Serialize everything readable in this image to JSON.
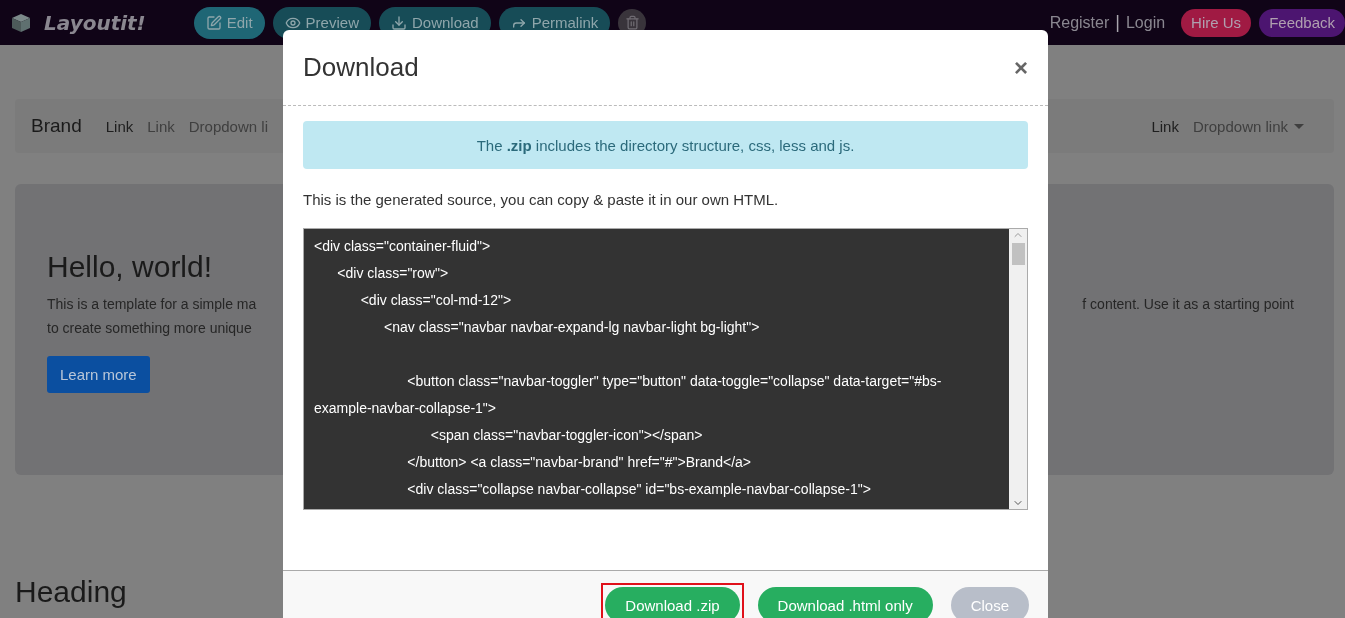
{
  "topbar": {
    "logo": "Layoutit!",
    "tools": [
      {
        "kind": "edit",
        "label": "Edit",
        "selected": true
      },
      {
        "kind": "preview",
        "label": "Preview",
        "selected": false
      },
      {
        "kind": "download",
        "label": "Download",
        "selected": false
      },
      {
        "kind": "permalink",
        "label": "Permalink",
        "selected": false
      },
      {
        "kind": "trash",
        "selected": false
      }
    ],
    "account": [
      {
        "kind": "link",
        "text": "Register"
      },
      {
        "kind": "separator",
        "text": "|"
      },
      {
        "kind": "link",
        "text": "Login"
      }
    ],
    "hire": "Hire Us",
    "feedback": "Feedback"
  },
  "page": {
    "navbar": {
      "brand": "Brand",
      "left_links": [
        {
          "label": "Link",
          "selected": true
        },
        {
          "label": "Link",
          "selected": false
        },
        {
          "label": "Dropdown li",
          "selected": false
        }
      ],
      "right_links": [
        {
          "label": "Link",
          "selected": true
        },
        {
          "label": "Dropdown link",
          "selected": false,
          "dropdown": true
        }
      ]
    },
    "jumbotron": {
      "title": "Hello, world!",
      "text_left": [
        "This is a template for a simple ma",
        "to create something more unique"
      ],
      "text_right": "f content. Use it as a starting point",
      "button": "Learn more"
    },
    "heading": "Heading"
  },
  "modal": {
    "title": "Download",
    "close": "×",
    "info": "The **.zip** includes the directory structure, css, less and js.",
    "intro": "This is the generated source, you can copy & paste it in our own HTML.",
    "code": "<div class=\"container-fluid\">\n\t<div class=\"row\">\n\t\t<div class=\"col-md-12\">\n\t\t\t<nav class=\"navbar navbar-expand-lg navbar-light bg-light\">\n\n\t\t\t\t<button class=\"navbar-toggler\" type=\"button\" data-toggle=\"collapse\" data-target=\"#bs-example-navbar-collapse-1\">\n\t\t\t\t\t<span class=\"navbar-toggler-icon\"></span>\n\t\t\t\t</button> <a class=\"navbar-brand\" href=\"#\">Brand</a>\n\t\t\t\t<div class=\"collapse navbar-collapse\" id=\"bs-example-navbar-collapse-1\">",
    "buttons": [
      {
        "label": "Download .zip",
        "kind": "primary",
        "highlighted": true
      },
      {
        "label": "Download .html only",
        "kind": "primary",
        "highlighted": false
      },
      {
        "label": "Close",
        "kind": "secondary",
        "highlighted": false
      }
    ]
  }
}
